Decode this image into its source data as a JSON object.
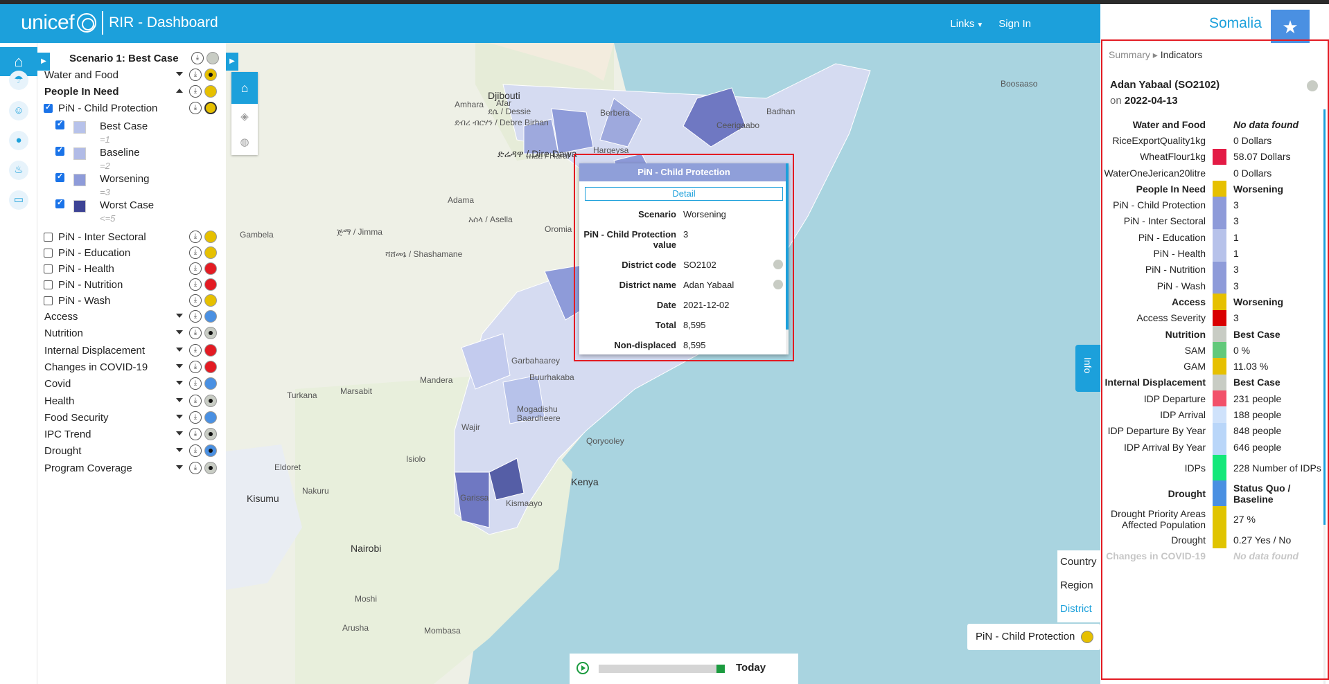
{
  "header": {
    "brand": "unicef",
    "app_title": "RIR - Dashboard",
    "links_label": "Links",
    "signin_label": "Sign In",
    "country": "Somalia"
  },
  "scenario_title": "Scenario 1: Best Case",
  "layers": {
    "groups_top": [
      {
        "label": "Water and Food",
        "dot": "#e6c000",
        "inner": true
      }
    ],
    "people_in_need": {
      "label": "People In Need",
      "dot": "#e6c000"
    },
    "pin_child": {
      "label": "PiN - Child Protection",
      "checked": true,
      "dot": "#e6c000"
    },
    "legend": [
      {
        "label": "Best Case",
        "sub": "=1",
        "color": "#b7c2ea"
      },
      {
        "label": "Baseline",
        "sub": "=2",
        "color": "#b1bbe6"
      },
      {
        "label": "Worsening",
        "sub": "=3",
        "color": "#8e9bd9"
      },
      {
        "label": "Worst Case",
        "sub": "<=5",
        "color": "#3d4394"
      }
    ],
    "pin_others": [
      {
        "label": "PiN - Inter Sectoral",
        "dot": "#e6c000"
      },
      {
        "label": "PiN - Education",
        "dot": "#e6c000"
      },
      {
        "label": "PiN - Health",
        "dot": "#e31b23"
      },
      {
        "label": "PiN - Nutrition",
        "dot": "#e31b23"
      },
      {
        "label": "PiN - Wash",
        "dot": "#e6c000"
      }
    ],
    "groups_bottom": [
      {
        "label": "Access",
        "dot": "#4a90e2"
      },
      {
        "label": "Nutrition",
        "dot": "#c8ccc4",
        "inner": true
      },
      {
        "label": "Internal Displacement",
        "dot": "#e31b23"
      },
      {
        "label": "Changes in COVID-19",
        "dot": "#e31b23"
      },
      {
        "label": "Covid",
        "dot": "#4a90e2"
      },
      {
        "label": "Health",
        "dot": "#c8ccc4",
        "inner": true
      },
      {
        "label": "Food Security",
        "dot": "#4a90e2"
      },
      {
        "label": "IPC Trend",
        "dot": "#c8ccc4",
        "inner": true
      },
      {
        "label": "Drought",
        "dot": "#4a90e2",
        "inner": true
      },
      {
        "label": "Program Coverage",
        "dot": "#c8ccc4",
        "inner": true
      }
    ]
  },
  "map_labels": [
    {
      "t": "Djibouti",
      "c": "big"
    },
    {
      "t": "Berbera"
    },
    {
      "t": "Boosaaso"
    },
    {
      "t": "Hargeysa"
    },
    {
      "t": "Ceerigaabo"
    },
    {
      "t": "Badhan"
    },
    {
      "t": "ድሬዳዋ / Dire Dawa",
      "c": "big"
    },
    {
      "t": "ሐረር / Harar"
    },
    {
      "t": "ደሴ / Dessie"
    },
    {
      "t": "ደብረ ብርሃን / Debre Birhan"
    },
    {
      "t": "ጅማ / Jimma"
    },
    {
      "t": "ሻሸመኔ / Shashamane"
    },
    {
      "t": "Adama"
    },
    {
      "t": "አሰላ / Asella"
    },
    {
      "t": "Oromia"
    },
    {
      "t": "Gambela"
    },
    {
      "t": "Amhara"
    },
    {
      "t": "Afar"
    },
    {
      "t": "Kenya",
      "c": "big"
    },
    {
      "t": "Nairobi",
      "c": "big"
    },
    {
      "t": "Kisumu",
      "c": "big"
    },
    {
      "t": "Mombasa"
    },
    {
      "t": "Arusha"
    },
    {
      "t": "Marsabit"
    },
    {
      "t": "Mandera"
    },
    {
      "t": "Wajir"
    },
    {
      "t": "Isiolo"
    },
    {
      "t": "Garissa"
    },
    {
      "t": "Turkana"
    },
    {
      "t": "Eldoret"
    },
    {
      "t": "Nakuru"
    },
    {
      "t": "Moshi"
    },
    {
      "t": "Mogadishu"
    },
    {
      "t": "Qoryooley"
    },
    {
      "t": "Baardheere"
    },
    {
      "t": "Kismaayo"
    },
    {
      "t": "Garbahaarey"
    },
    {
      "t": "Buurhakaba"
    }
  ],
  "popup": {
    "title": "PiN - Child Protection",
    "detail_label": "Detail",
    "rows": [
      {
        "k": "Scenario",
        "v": "Worsening"
      },
      {
        "k": "PiN - Child Protection value",
        "v": "3"
      },
      {
        "k": "District code",
        "v": "SO2102",
        "dot": true
      },
      {
        "k": "District name",
        "v": "Adan Yabaal",
        "dot": true
      },
      {
        "k": "Date",
        "v": "2021-12-02"
      },
      {
        "k": "Total",
        "v": "8,595"
      },
      {
        "k": "Non-displaced",
        "v": "8,595"
      }
    ]
  },
  "levels": [
    "Country",
    "Region",
    "District"
  ],
  "active_level": "District",
  "legend_chip": "PiN - Child Protection",
  "timeline_label": "Today",
  "info_tab": "Info",
  "panel": {
    "crumb_summary": "Summary",
    "crumb_current": "Indicators",
    "district_title": "Adan Yabaal (SO2102)",
    "on_label": "on",
    "date": "2022-04-13",
    "rows": [
      {
        "k": "Water and Food",
        "v": "No data found",
        "h": true,
        "italic": true,
        "color": ""
      },
      {
        "k": "RiceExportQuality1kg",
        "v": "0 Dollars",
        "color": ""
      },
      {
        "k": "WheatFlour1kg",
        "v": "58.07 Dollars",
        "color": "#e31b45"
      },
      {
        "k": "WaterOneJerican20litre",
        "v": "0 Dollars",
        "color": ""
      },
      {
        "k": "People In Need",
        "v": "Worsening",
        "h": true,
        "color": "#e6c000"
      },
      {
        "k": "PiN - Child Protection",
        "v": "3",
        "color": "#8e9bd9"
      },
      {
        "k": "PiN - Inter Sectoral",
        "v": "3",
        "color": "#8e9bd9"
      },
      {
        "k": "PiN - Education",
        "v": "1",
        "color": "#b7c2ea"
      },
      {
        "k": "PiN - Health",
        "v": "1",
        "color": "#b7c2ea"
      },
      {
        "k": "PiN - Nutrition",
        "v": "3",
        "color": "#8e9bd9"
      },
      {
        "k": "PiN - Wash",
        "v": "3",
        "color": "#8e9bd9"
      },
      {
        "k": "Access",
        "v": "Worsening",
        "h": true,
        "color": "#e6c000"
      },
      {
        "k": "Access Severity",
        "v": "3",
        "color": "#d90000"
      },
      {
        "k": "Nutrition",
        "v": "Best Case",
        "h": true,
        "color": "#c8ccc4"
      },
      {
        "k": "SAM",
        "v": "0 %",
        "color": "#62c97a"
      },
      {
        "k": "GAM",
        "v": "11.03 %",
        "color": "#e6c000"
      },
      {
        "k": "Internal Displacement",
        "v": "Best Case",
        "h": true,
        "color": "#c8ccc4"
      },
      {
        "k": "IDP Departure",
        "v": "231 people",
        "color": "#f2516a"
      },
      {
        "k": "IDP Arrival",
        "v": "188 people",
        "color": "#cfe2fb"
      },
      {
        "k": "IDP Departure By Year",
        "v": "848 people",
        "color": "#b9d6f9"
      },
      {
        "k": "IDP Arrival By Year",
        "v": "646 people",
        "color": "#b9d6f9"
      },
      {
        "k": "IDPs",
        "v": "228 Number of IDPs",
        "color": "#14e87a",
        "tall": true
      },
      {
        "k": "Drought",
        "v": "Status Quo / Baseline",
        "h": true,
        "color": "#4a90e2",
        "tall": true
      },
      {
        "k": "Drought Priority Areas Affected Population",
        "v": "27 %",
        "color": "#e0c400",
        "tall": true
      },
      {
        "k": "Drought",
        "v": "0.27 Yes / No",
        "color": "#e0c400"
      },
      {
        "k": "Changes in COVID-19",
        "v": "No data found",
        "h": true,
        "italic": true,
        "color": "",
        "faded": true
      }
    ]
  }
}
